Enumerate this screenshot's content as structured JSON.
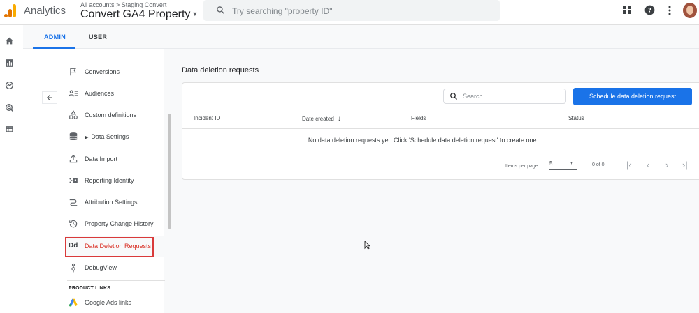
{
  "header": {
    "app_name": "Analytics",
    "breadcrumb": "All accounts > Staging Convert",
    "property_name": "Convert GA4 Property",
    "search_placeholder": "Try searching \"property ID\"",
    "icons": [
      "apps-grid-icon",
      "help-icon",
      "more-vert-icon",
      "avatar"
    ]
  },
  "rail": {
    "icons": [
      "home-icon",
      "reports-icon",
      "explore-icon",
      "advertising-icon",
      "configure-icon"
    ]
  },
  "tabs": {
    "admin": "ADMIN",
    "user": "USER",
    "active": "ADMIN"
  },
  "sidebar": {
    "items": [
      {
        "label": "Conversions",
        "icon": "flag-icon"
      },
      {
        "label": "Audiences",
        "icon": "audiences-icon"
      },
      {
        "label": "Custom definitions",
        "icon": "shapes-icon"
      },
      {
        "label": "Data Settings",
        "icon": "database-icon"
      },
      {
        "label": "Data Import",
        "icon": "upload-icon"
      },
      {
        "label": "Reporting Identity",
        "icon": "identity-icon"
      },
      {
        "label": "Attribution Settings",
        "icon": "attribution-icon"
      },
      {
        "label": "Property Change History",
        "icon": "history-icon"
      },
      {
        "label": "Data Deletion Requests",
        "icon": "dd-icon"
      },
      {
        "label": "DebugView",
        "icon": "debug-icon"
      }
    ],
    "active_icon_text": "Dd",
    "section_header": "PRODUCT LINKS",
    "links": [
      {
        "label": "Google Ads links",
        "icon": "google-ads-icon"
      }
    ]
  },
  "main": {
    "title": "Data deletion requests",
    "search_placeholder": "Search",
    "primary_button": "Schedule data deletion request",
    "columns": [
      "Incident ID",
      "Date created",
      "Fields",
      "Status"
    ],
    "sort_indicator": "↓",
    "empty_message": "No data deletion requests yet. Click 'Schedule data deletion request' to create one.",
    "pagination": {
      "items_per_page_label": "Items per page:",
      "items_per_page_value": "5",
      "range": "0 of 0"
    }
  },
  "colors": {
    "brand_blue": "#1a73e8",
    "highlight_red": "#d93a3a",
    "active_text": "#d93025",
    "ga_orange": "#f9ab00",
    "ga_dark_orange": "#e37400"
  }
}
